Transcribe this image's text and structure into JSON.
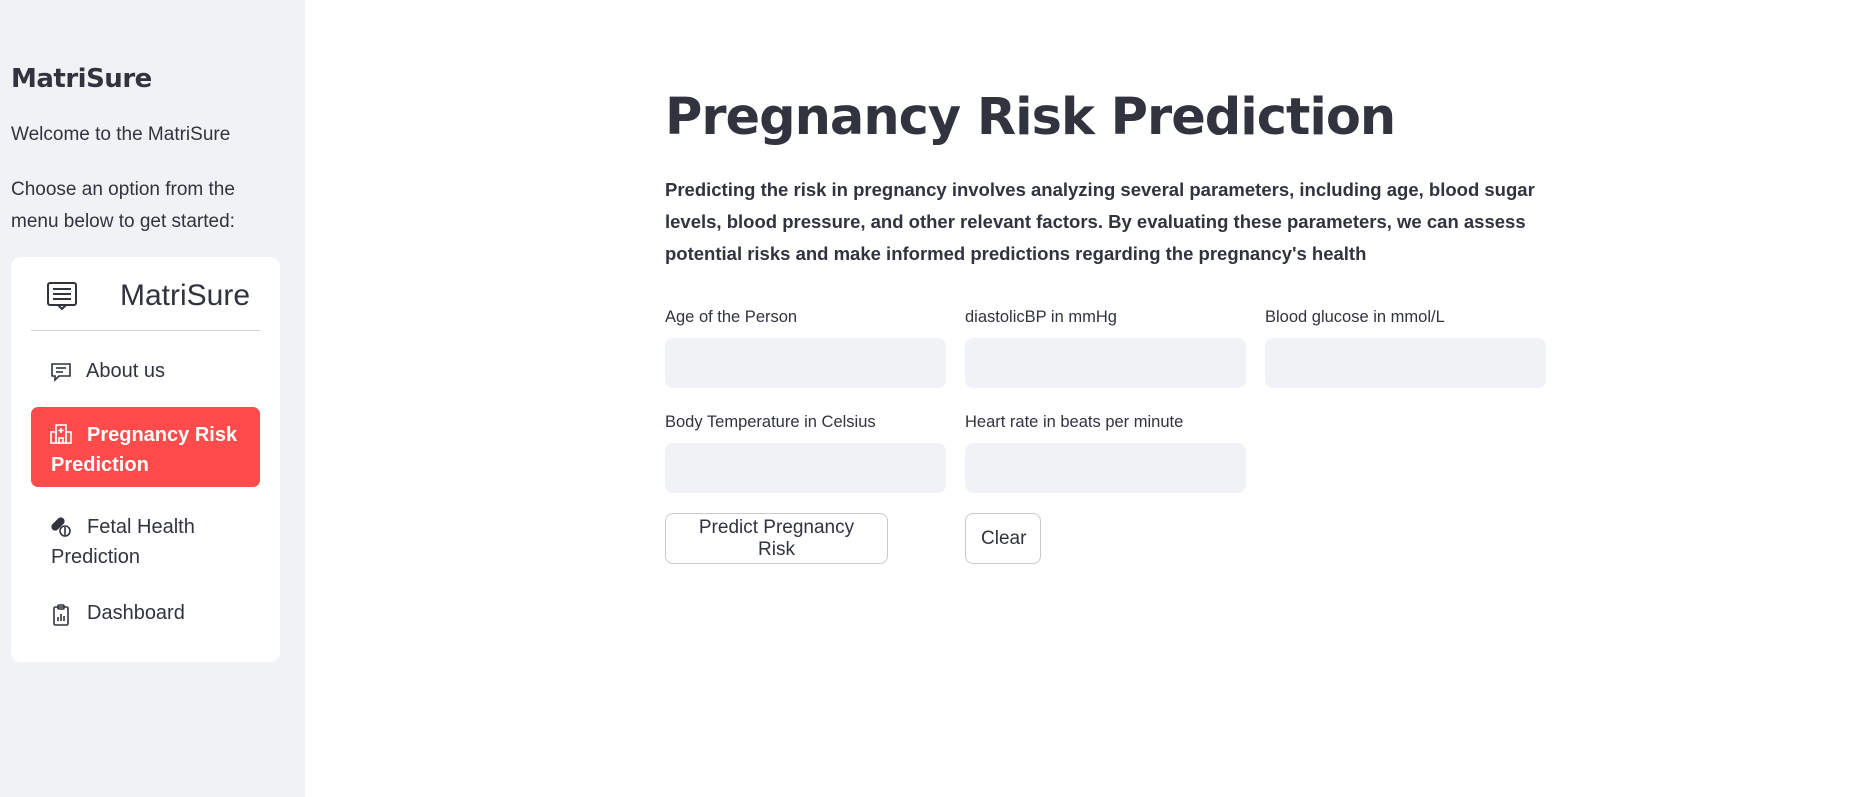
{
  "sidebar": {
    "title": "MatriSure",
    "welcome": "Welcome to the MatriSure",
    "choose": "Choose an option from the menu below to get started:",
    "menu": {
      "title": "MatriSure",
      "title_icon": "list-alt-icon",
      "items": [
        {
          "label": "About us",
          "icon": "chat-text-icon",
          "active": false
        },
        {
          "label": "Pregnancy Risk Prediction",
          "icon": "hospital-icon",
          "active": true
        },
        {
          "label": "Fetal Health Prediction",
          "icon": "capsule-pill-icon",
          "active": false
        },
        {
          "label": "Dashboard",
          "icon": "clipboard-data-icon",
          "active": false
        }
      ],
      "active_color": "#ff4b4b"
    }
  },
  "main": {
    "title": "Pregnancy Risk Prediction",
    "description": "Predicting the risk in pregnancy involves analyzing several parameters, including age, blood sugar levels, blood pressure, and other relevant factors. By evaluating these parameters, we can assess potential risks and make informed predictions regarding the pregnancy's health",
    "fields": [
      {
        "label": "Age of the Person",
        "value": ""
      },
      {
        "label": "diastolicBP in mmHg",
        "value": ""
      },
      {
        "label": "Blood glucose in mmol/L",
        "value": ""
      },
      {
        "label": "Body Temperature in Celsius",
        "value": ""
      },
      {
        "label": "Heart rate in beats per minute",
        "value": ""
      }
    ],
    "buttons": {
      "predict": "Predict Pregnancy Risk",
      "clear": "Clear"
    }
  }
}
